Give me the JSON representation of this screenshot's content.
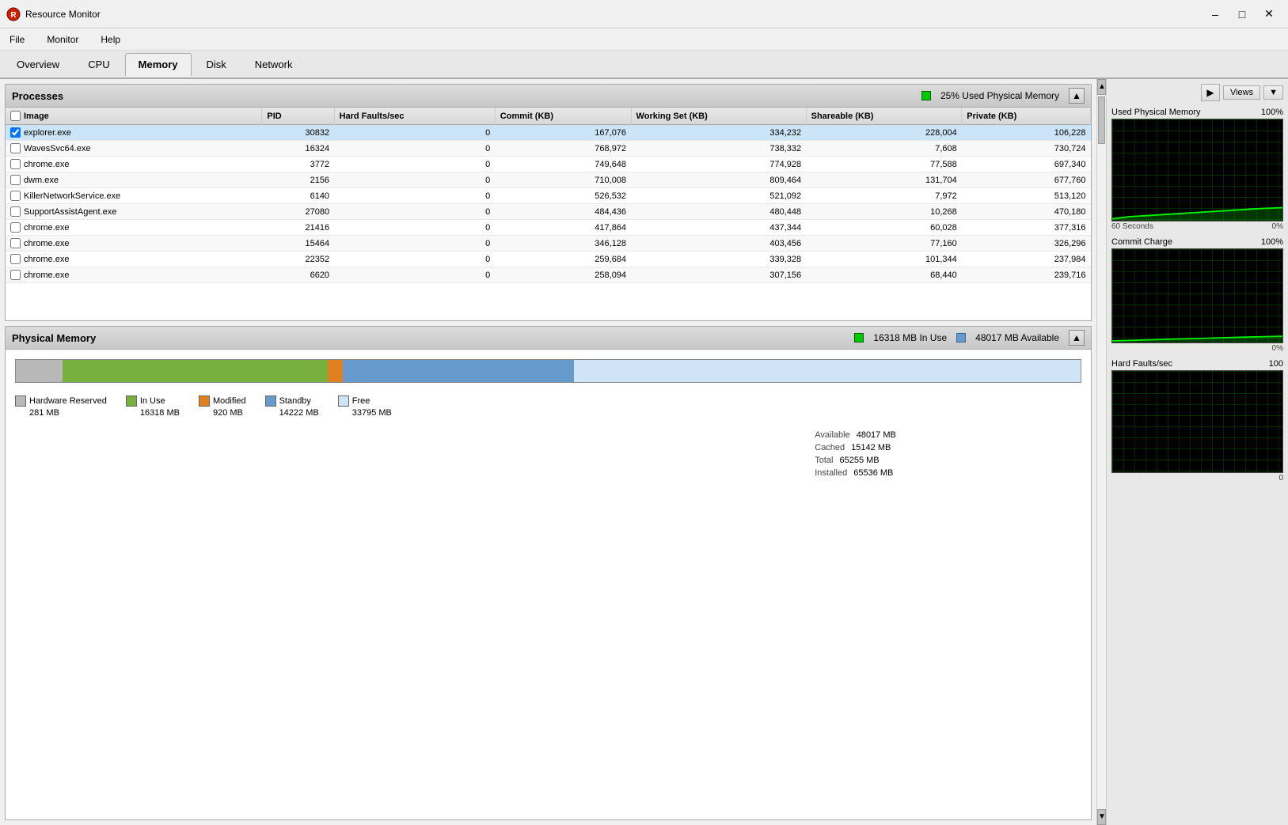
{
  "titleBar": {
    "title": "Resource Monitor",
    "icon": "resource-monitor"
  },
  "menuBar": {
    "items": [
      "File",
      "Monitor",
      "Help"
    ]
  },
  "tabs": [
    {
      "label": "Overview",
      "active": false
    },
    {
      "label": "CPU",
      "active": false
    },
    {
      "label": "Memory",
      "active": true
    },
    {
      "label": "Disk",
      "active": false
    },
    {
      "label": "Network",
      "active": false
    }
  ],
  "processes": {
    "sectionLabel": "Processes",
    "statusLabel": "25% Used Physical Memory",
    "columns": [
      "Image",
      "PID",
      "Hard Faults/sec",
      "Commit (KB)",
      "Working Set (KB)",
      "Shareable (KB)",
      "Private (KB)"
    ],
    "rows": [
      {
        "checked": true,
        "image": "explorer.exe",
        "pid": "30832",
        "hardFaults": "0",
        "commit": "167,076",
        "workingSet": "334,232",
        "shareable": "228,004",
        "private": "106,228"
      },
      {
        "checked": false,
        "image": "WavesSvc64.exe",
        "pid": "16324",
        "hardFaults": "0",
        "commit": "768,972",
        "workingSet": "738,332",
        "shareable": "7,608",
        "private": "730,724"
      },
      {
        "checked": false,
        "image": "chrome.exe",
        "pid": "3772",
        "hardFaults": "0",
        "commit": "749,648",
        "workingSet": "774,928",
        "shareable": "77,588",
        "private": "697,340"
      },
      {
        "checked": false,
        "image": "dwm.exe",
        "pid": "2156",
        "hardFaults": "0",
        "commit": "710,008",
        "workingSet": "809,464",
        "shareable": "131,704",
        "private": "677,760"
      },
      {
        "checked": false,
        "image": "KillerNetworkService.exe",
        "pid": "6140",
        "hardFaults": "0",
        "commit": "526,532",
        "workingSet": "521,092",
        "shareable": "7,972",
        "private": "513,120"
      },
      {
        "checked": false,
        "image": "SupportAssistAgent.exe",
        "pid": "27080",
        "hardFaults": "0",
        "commit": "484,436",
        "workingSet": "480,448",
        "shareable": "10,268",
        "private": "470,180"
      },
      {
        "checked": false,
        "image": "chrome.exe",
        "pid": "21416",
        "hardFaults": "0",
        "commit": "417,864",
        "workingSet": "437,344",
        "shareable": "60,028",
        "private": "377,316"
      },
      {
        "checked": false,
        "image": "chrome.exe",
        "pid": "15464",
        "hardFaults": "0",
        "commit": "346,128",
        "workingSet": "403,456",
        "shareable": "77,160",
        "private": "326,296"
      },
      {
        "checked": false,
        "image": "chrome.exe",
        "pid": "22352",
        "hardFaults": "0",
        "commit": "259,684",
        "workingSet": "339,328",
        "shareable": "101,344",
        "private": "237,984"
      },
      {
        "checked": false,
        "image": "chrome.exe",
        "pid": "6620",
        "hardFaults": "0",
        "commit": "258,094",
        "workingSet": "307,156",
        "shareable": "68,440",
        "private": "239,716"
      }
    ]
  },
  "physicalMemory": {
    "sectionLabel": "Physical Memory",
    "inUseLabel": "16318 MB In Use",
    "availableLabel": "48017 MB Available",
    "legend": [
      {
        "type": "hw",
        "label": "Hardware Reserved",
        "value": "281 MB"
      },
      {
        "type": "inuse",
        "label": "In Use",
        "value": "16318 MB"
      },
      {
        "type": "modified",
        "label": "Modified",
        "value": "920 MB"
      },
      {
        "type": "standby",
        "label": "Standby",
        "value": "14222 MB"
      },
      {
        "type": "free",
        "label": "Free",
        "value": "33795 MB"
      }
    ],
    "stats": [
      {
        "label": "Available",
        "value": "48017 MB"
      },
      {
        "label": "Cached",
        "value": "15142 MB"
      },
      {
        "label": "Total",
        "value": "65255 MB"
      },
      {
        "label": "Installed",
        "value": "65536 MB"
      }
    ]
  },
  "rightPanel": {
    "viewsLabel": "Views",
    "charts": [
      {
        "label": "Used Physical Memory",
        "maxLabel": "100%",
        "bottomLeft": "60 Seconds",
        "bottomRight": "0%"
      },
      {
        "label": "Commit Charge",
        "maxLabel": "100%",
        "bottomLeft": "",
        "bottomRight": "0%"
      },
      {
        "label": "Hard Faults/sec",
        "maxLabel": "100",
        "bottomLeft": "",
        "bottomRight": "0"
      }
    ]
  }
}
